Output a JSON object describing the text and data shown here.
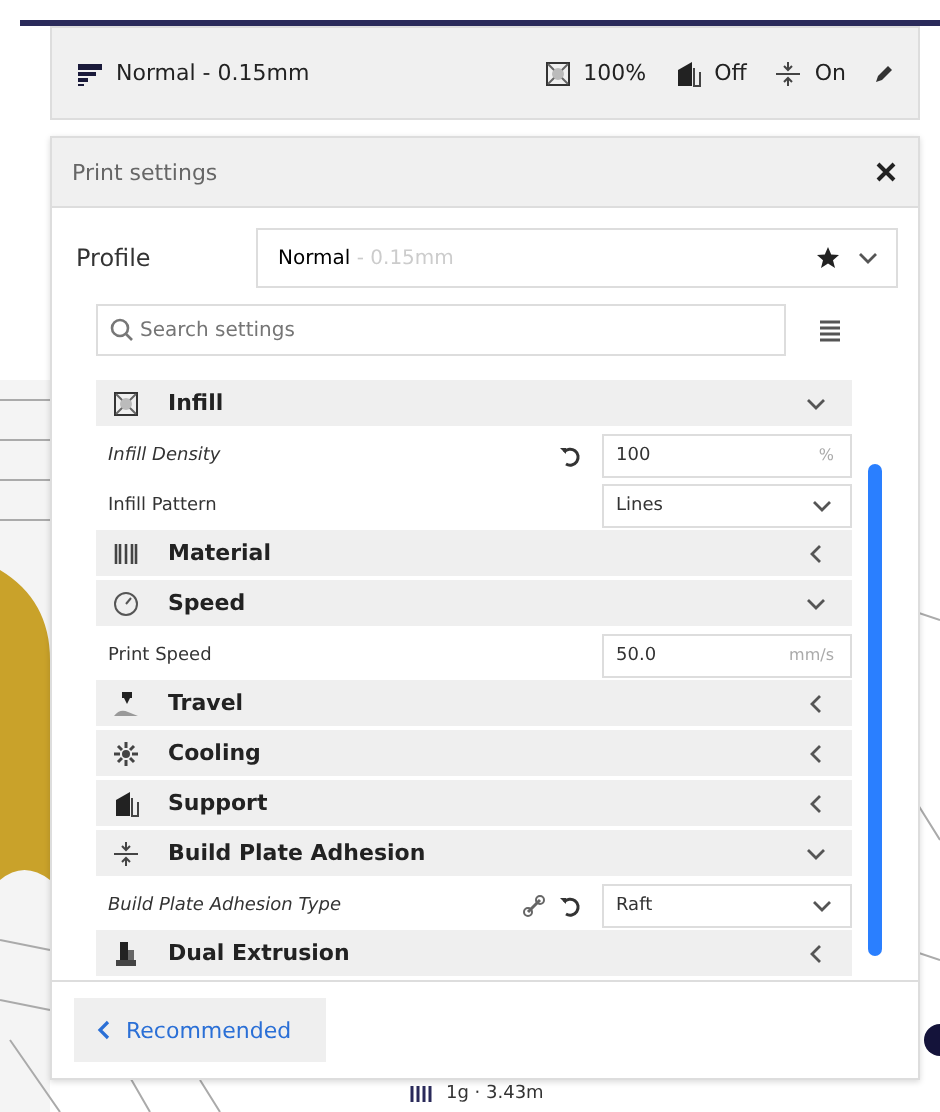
{
  "header": {
    "profile": "Normal - 0.15mm",
    "infill": "100%",
    "support": "Off",
    "adhesion": "On"
  },
  "panel": {
    "title": "Print settings",
    "profile_label": "Profile",
    "profile_name": "Normal",
    "profile_detail": " - 0.15mm",
    "search": {
      "placeholder": "Search settings"
    }
  },
  "settings": [
    {
      "kind": "category",
      "label": "Infill",
      "expanded": true
    },
    {
      "kind": "text",
      "label": "Infill Density",
      "modified": true,
      "value": "100",
      "unit": "%",
      "linked": false
    },
    {
      "kind": "dropdown",
      "label": "Infill Pattern",
      "modified": false,
      "value": "Lines",
      "linked": false
    },
    {
      "kind": "category",
      "label": "Material",
      "expanded": false
    },
    {
      "kind": "category",
      "label": "Speed",
      "expanded": true
    },
    {
      "kind": "text",
      "label": "Print Speed",
      "modified": false,
      "value": "50.0",
      "unit": "mm/s",
      "linked": false
    },
    {
      "kind": "category",
      "label": "Travel",
      "expanded": false
    },
    {
      "kind": "category",
      "label": "Cooling",
      "expanded": false
    },
    {
      "kind": "category",
      "label": "Support",
      "expanded": false
    },
    {
      "kind": "category",
      "label": "Build Plate Adhesion",
      "expanded": true
    },
    {
      "kind": "dropdown",
      "label": "Build Plate Adhesion Type",
      "modified": true,
      "value": "Raft",
      "linked": true
    },
    {
      "kind": "category",
      "label": "Dual Extrusion",
      "expanded": false
    }
  ],
  "footer": {
    "button": "Recommended"
  },
  "viewport": {
    "estimate": "1g · 3.43m"
  }
}
